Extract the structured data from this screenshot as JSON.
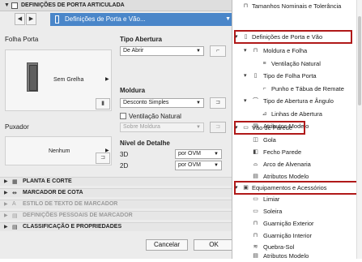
{
  "dialog": {
    "header_title": "DEFINIÇÕES DE PORTA ARTICULADA",
    "nav_selection": "Definições de Porta e Vão...",
    "folha_porta_label": "Folha Porta",
    "door_panel_value": "Sem Grelha",
    "tipo_abertura_label": "Tipo Abertura",
    "tipo_abertura_value": "De Abrir",
    "moldura_label": "Moldura",
    "moldura_value": "Desconto Simples",
    "ventilacao_label": "Ventilação Natural",
    "ventilacao_value": "Sobre Moldura",
    "puxador_label": "Puxador",
    "puxador_value": "Nenhum",
    "nivel_detalhe_label": "Nível de Detalhe",
    "detail_3d_label": "3D",
    "detail_3d_value": "por OVM",
    "detail_2d_label": "2D",
    "detail_2d_value": "por OVM",
    "sections": [
      {
        "label": "PLANTA E CORTE",
        "disabled": false
      },
      {
        "label": "MARCADOR DE COTA",
        "disabled": false
      },
      {
        "label": "ESTILO DE TEXTO DE MARCADOR",
        "disabled": true
      },
      {
        "label": "DEFINIÇÕES PESSOAIS DE MARCADOR",
        "disabled": true
      },
      {
        "label": "CLASSIFICAÇÃO E PROPRIEDADES",
        "disabled": false
      }
    ],
    "cancel_label": "Cancelar",
    "ok_label": "OK"
  },
  "tree": {
    "items": [
      {
        "label": "Tamanhos Nominais e Tolerância",
        "level": 0,
        "icon": "ruler-icon"
      },
      {
        "label": "Definições de Porta e Vão",
        "level": 0,
        "icon": "door-icon",
        "expanded": true
      },
      {
        "label": "Moldura e Folha",
        "level": 1,
        "icon": "frame-icon",
        "expanded": true
      },
      {
        "label": "Ventilação Natural",
        "level": 2,
        "icon": "vent-icon"
      },
      {
        "label": "Tipo de Folha Porta",
        "level": 1,
        "icon": "panel-icon",
        "expanded": true
      },
      {
        "label": "Punho e Tábua de Remate",
        "level": 2,
        "icon": "handle-icon"
      },
      {
        "label": "Tipo de Abertura e Ângulo",
        "level": 1,
        "icon": "opening-icon",
        "expanded": true
      },
      {
        "label": "Linhas de Abertura",
        "level": 2,
        "icon": "lines-icon"
      },
      {
        "label": "Atributos Modelo",
        "level": 1,
        "icon": "attributes-icon"
      },
      {
        "label": "Vão de Parede",
        "level": 0,
        "icon": "wall-opening-icon",
        "expanded": true
      },
      {
        "label": "Gola",
        "level": 1,
        "icon": "reveal-icon"
      },
      {
        "label": "Fecho Parede",
        "level": 1,
        "icon": "wall-closure-icon"
      },
      {
        "label": "Arco de Alvenaria",
        "level": 1,
        "icon": "arch-icon"
      },
      {
        "label": "Atributos Modelo",
        "level": 1,
        "icon": "attributes-icon"
      },
      {
        "label": "Equipamentos e Acessórios",
        "level": 0,
        "icon": "accessories-icon",
        "expanded": true
      },
      {
        "label": "Limiar",
        "level": 1,
        "icon": "threshold-icon"
      },
      {
        "label": "Soleira",
        "level": 1,
        "icon": "sill-icon"
      },
      {
        "label": "Guarnição Exterior",
        "level": 1,
        "icon": "trim-icon"
      },
      {
        "label": "Guarnição Interior",
        "level": 1,
        "icon": "trim-icon"
      },
      {
        "label": "Quebra-Sol",
        "level": 1,
        "icon": "sunshade-icon"
      },
      {
        "label": "Atributos Modelo",
        "level": 1,
        "icon": "attributes-icon"
      }
    ],
    "highlighted": [
      "Definições de Porta e Vão",
      "Vão de Parede",
      "Equipamentos e Acessórios"
    ],
    "highlight_color": "#b01919"
  },
  "colors": {
    "selection": "#4a86c9",
    "highlight": "#b01919"
  }
}
